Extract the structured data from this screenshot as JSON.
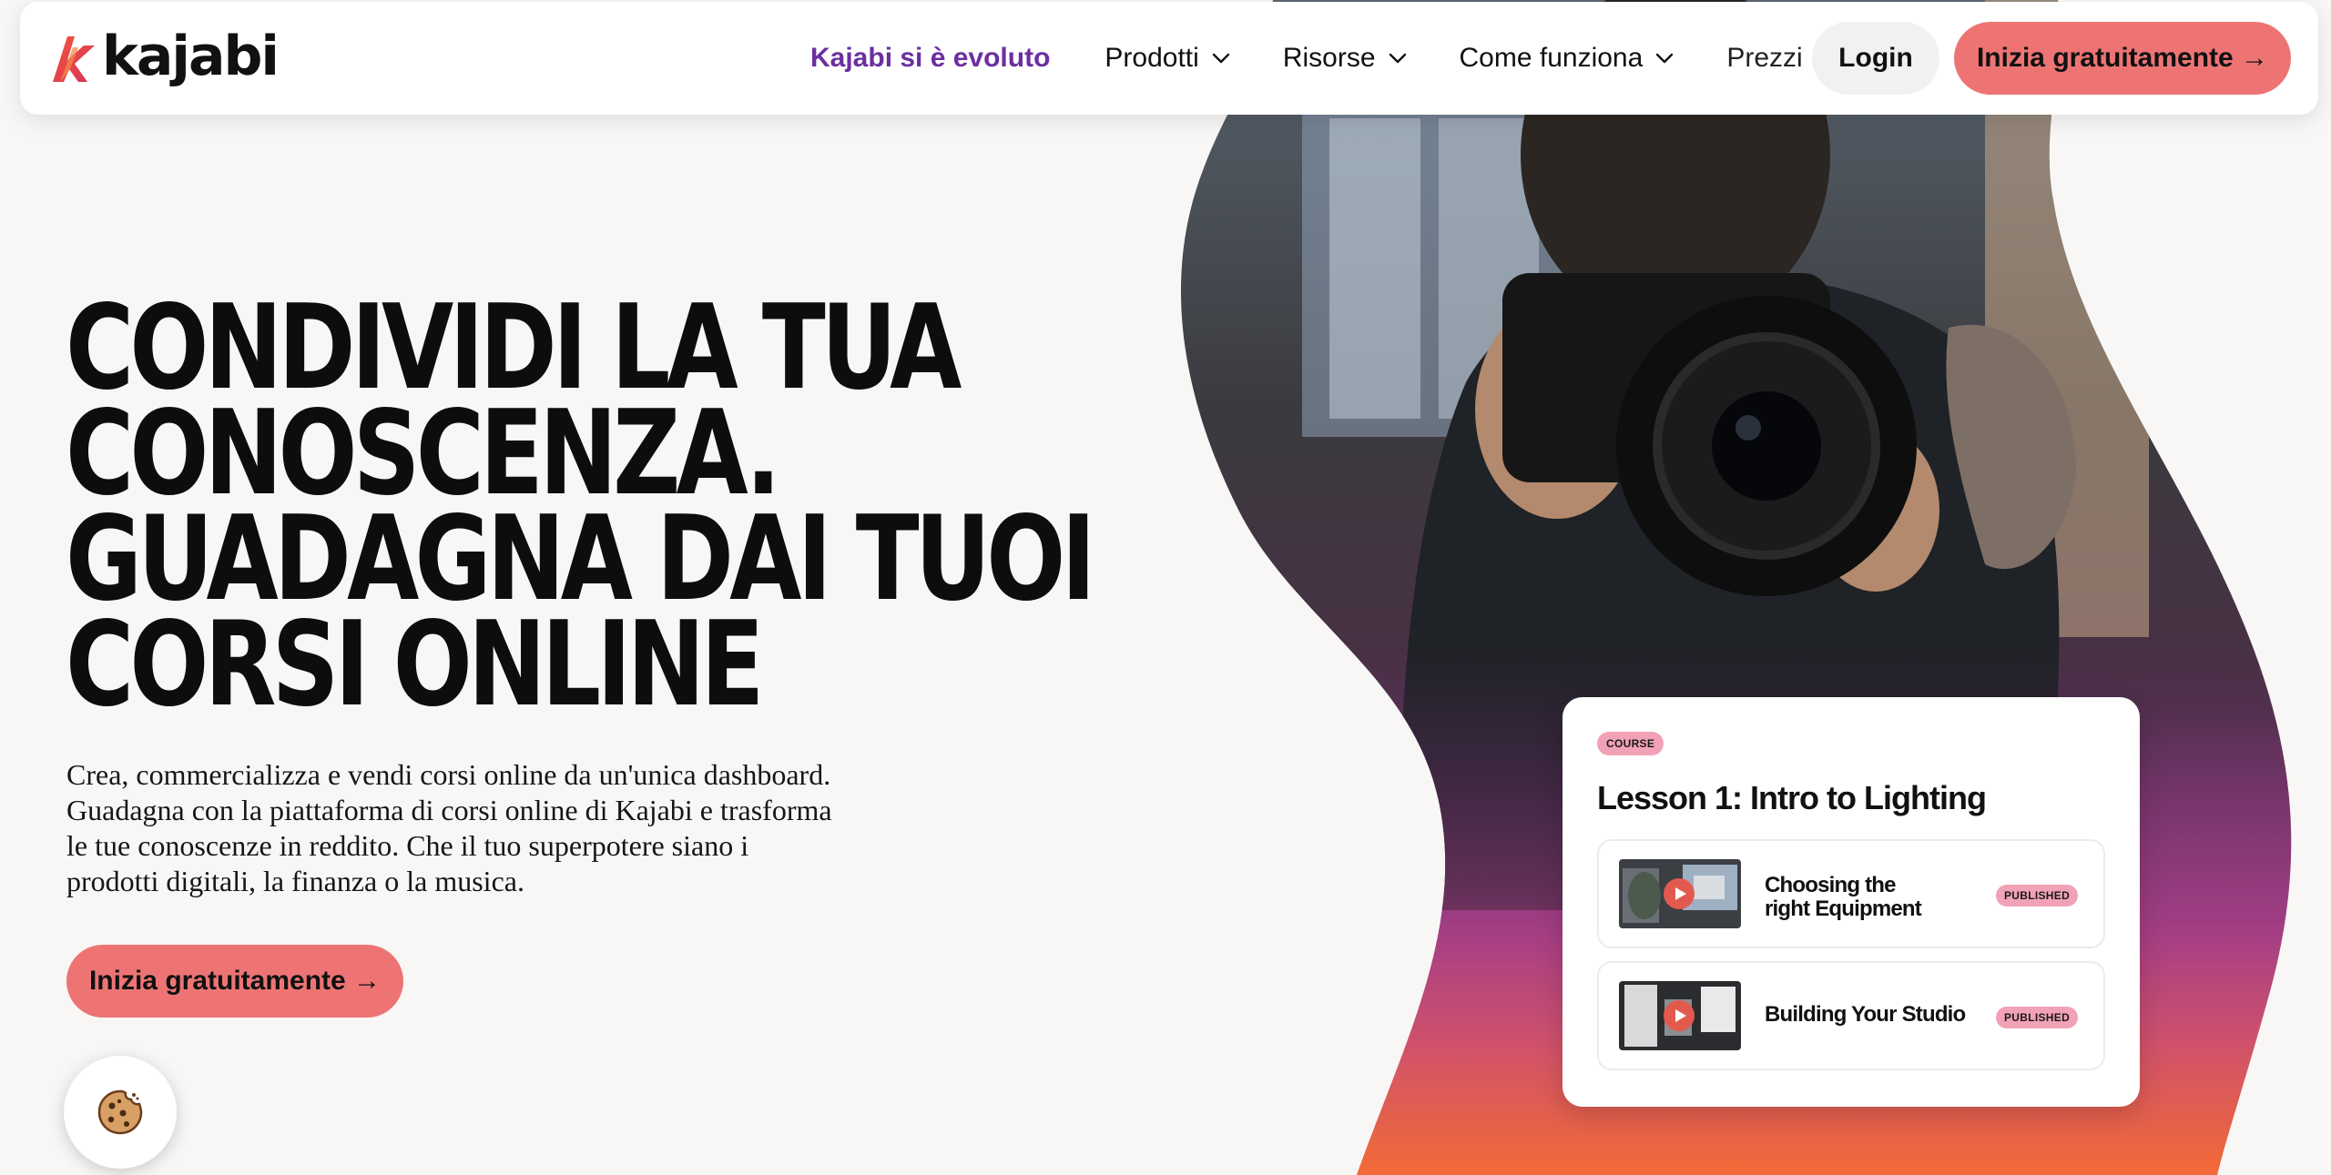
{
  "nav": {
    "logo_text": "kajabi",
    "links": [
      {
        "label": "Kajabi si è evoluto"
      },
      {
        "label": "Prodotti"
      },
      {
        "label": "Risorse"
      },
      {
        "label": "Come funziona"
      },
      {
        "label": "Prezzi"
      }
    ],
    "login_label": "Login",
    "cta_label": "Inizia gratuitamente →"
  },
  "hero": {
    "headline_lines": [
      "CONDIVIDI LA TUA",
      "CONOSCENZA.",
      "GUADAGNA DAI TUOI",
      "CORSI ONLINE"
    ],
    "subtext_lines": [
      "Crea, commercializza e vendi corsi online da un'unica dashboard.",
      "Guadagna con la piattaforma di corsi online di Kajabi e trasforma",
      "le tue conoscenze in reddito. Che il tuo superpotere siano i",
      "prodotti digitali, la finanza o la musica."
    ],
    "cta_label": "Inizia gratuitamente →"
  },
  "course_card": {
    "badge": "COURSE",
    "title": "Lesson 1: Intro to Lighting",
    "lessons": [
      {
        "title_line1": "Choosing the",
        "title_line2": "right Equipment",
        "status": "PUBLISHED"
      },
      {
        "title": "Building Your Studio",
        "status": "PUBLISHED"
      }
    ]
  },
  "colors": {
    "accent_purple": "#6b2fa0",
    "cta_coral": "#ee7474",
    "badge_pink": "#f2a2b6",
    "page_bg": "#f8f7f5"
  },
  "icons": {
    "logo": "kajabi-k-logo",
    "dropdown": "chevron-down-icon",
    "cookie": "cookie-icon",
    "play": "play-icon"
  }
}
